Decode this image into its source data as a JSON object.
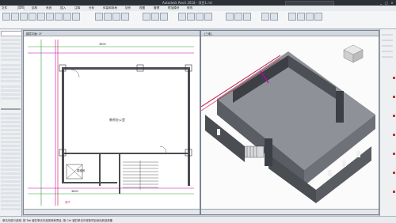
{
  "window": {
    "title": "Autodesk Revit 2018 - 项目1.rvt",
    "search_placeholder": "键入关键字或短语"
  },
  "menu": {
    "items": [
      "文件",
      "建筑",
      "结构",
      "系统",
      "插入",
      "注释",
      "分析",
      "体量和场地",
      "协作",
      "视图",
      "管理",
      "附加模块",
      "修改"
    ]
  },
  "plan_view": {
    "tab_label": "楼层平面: 1F",
    "room_name": "教师办公室",
    "room_name_2": "楼梯间",
    "dim_top": "3900",
    "dim_bottom": "3600",
    "stair_label": "向下"
  },
  "view3d": {
    "tab_label": "{三维}"
  },
  "status": {
    "text": "单击可进行选择; 按 Tab 键并单击可选择其他项目; 按 Ctrl 键并单击可将新项目添加到选择集"
  },
  "colors": {
    "accent_red": "#d0103a",
    "accent_magenta": "#c000c0",
    "dim_line": "#2aa02a",
    "wall": "#4a4d52"
  }
}
